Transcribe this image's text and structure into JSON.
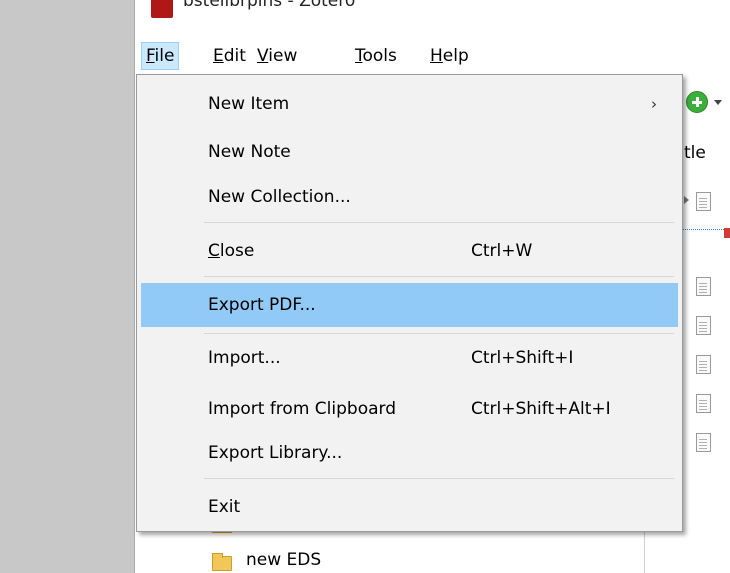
{
  "window": {
    "title": "bstelibrpins - Zotero"
  },
  "menubar": [
    {
      "pre": "",
      "u": "F",
      "post": "ile"
    },
    {
      "pre": "",
      "u": "E",
      "post": "dit"
    },
    {
      "pre": "",
      "u": "V",
      "post": "iew"
    },
    {
      "pre": "",
      "u": "T",
      "post": "ools"
    },
    {
      "pre": "",
      "u": "H",
      "post": "elp"
    }
  ],
  "items_pane": {
    "column_header": "tle"
  },
  "file_menu": {
    "new_item": "New Item",
    "new_item_arrow": "›",
    "new_note": "New Note",
    "new_collection": "New Collection...",
    "close_u": "C",
    "close_rest": "lose",
    "close_shortcut": "Ctrl+W",
    "export_pdf": "Export PDF...",
    "import": "Import...",
    "import_shortcut": "Ctrl+Shift+I",
    "import_clipboard": "Import from Clipboard",
    "import_clipboard_shortcut": "Ctrl+Shift+Alt+I",
    "export_library": "Export Library...",
    "exit": "Exit"
  },
  "collections": {
    "visible_folder": "new EDS"
  },
  "colors": {
    "highlight": "#91c9f7",
    "active_menu": "#cce8ff",
    "menu_bg": "#f2f2f2"
  }
}
